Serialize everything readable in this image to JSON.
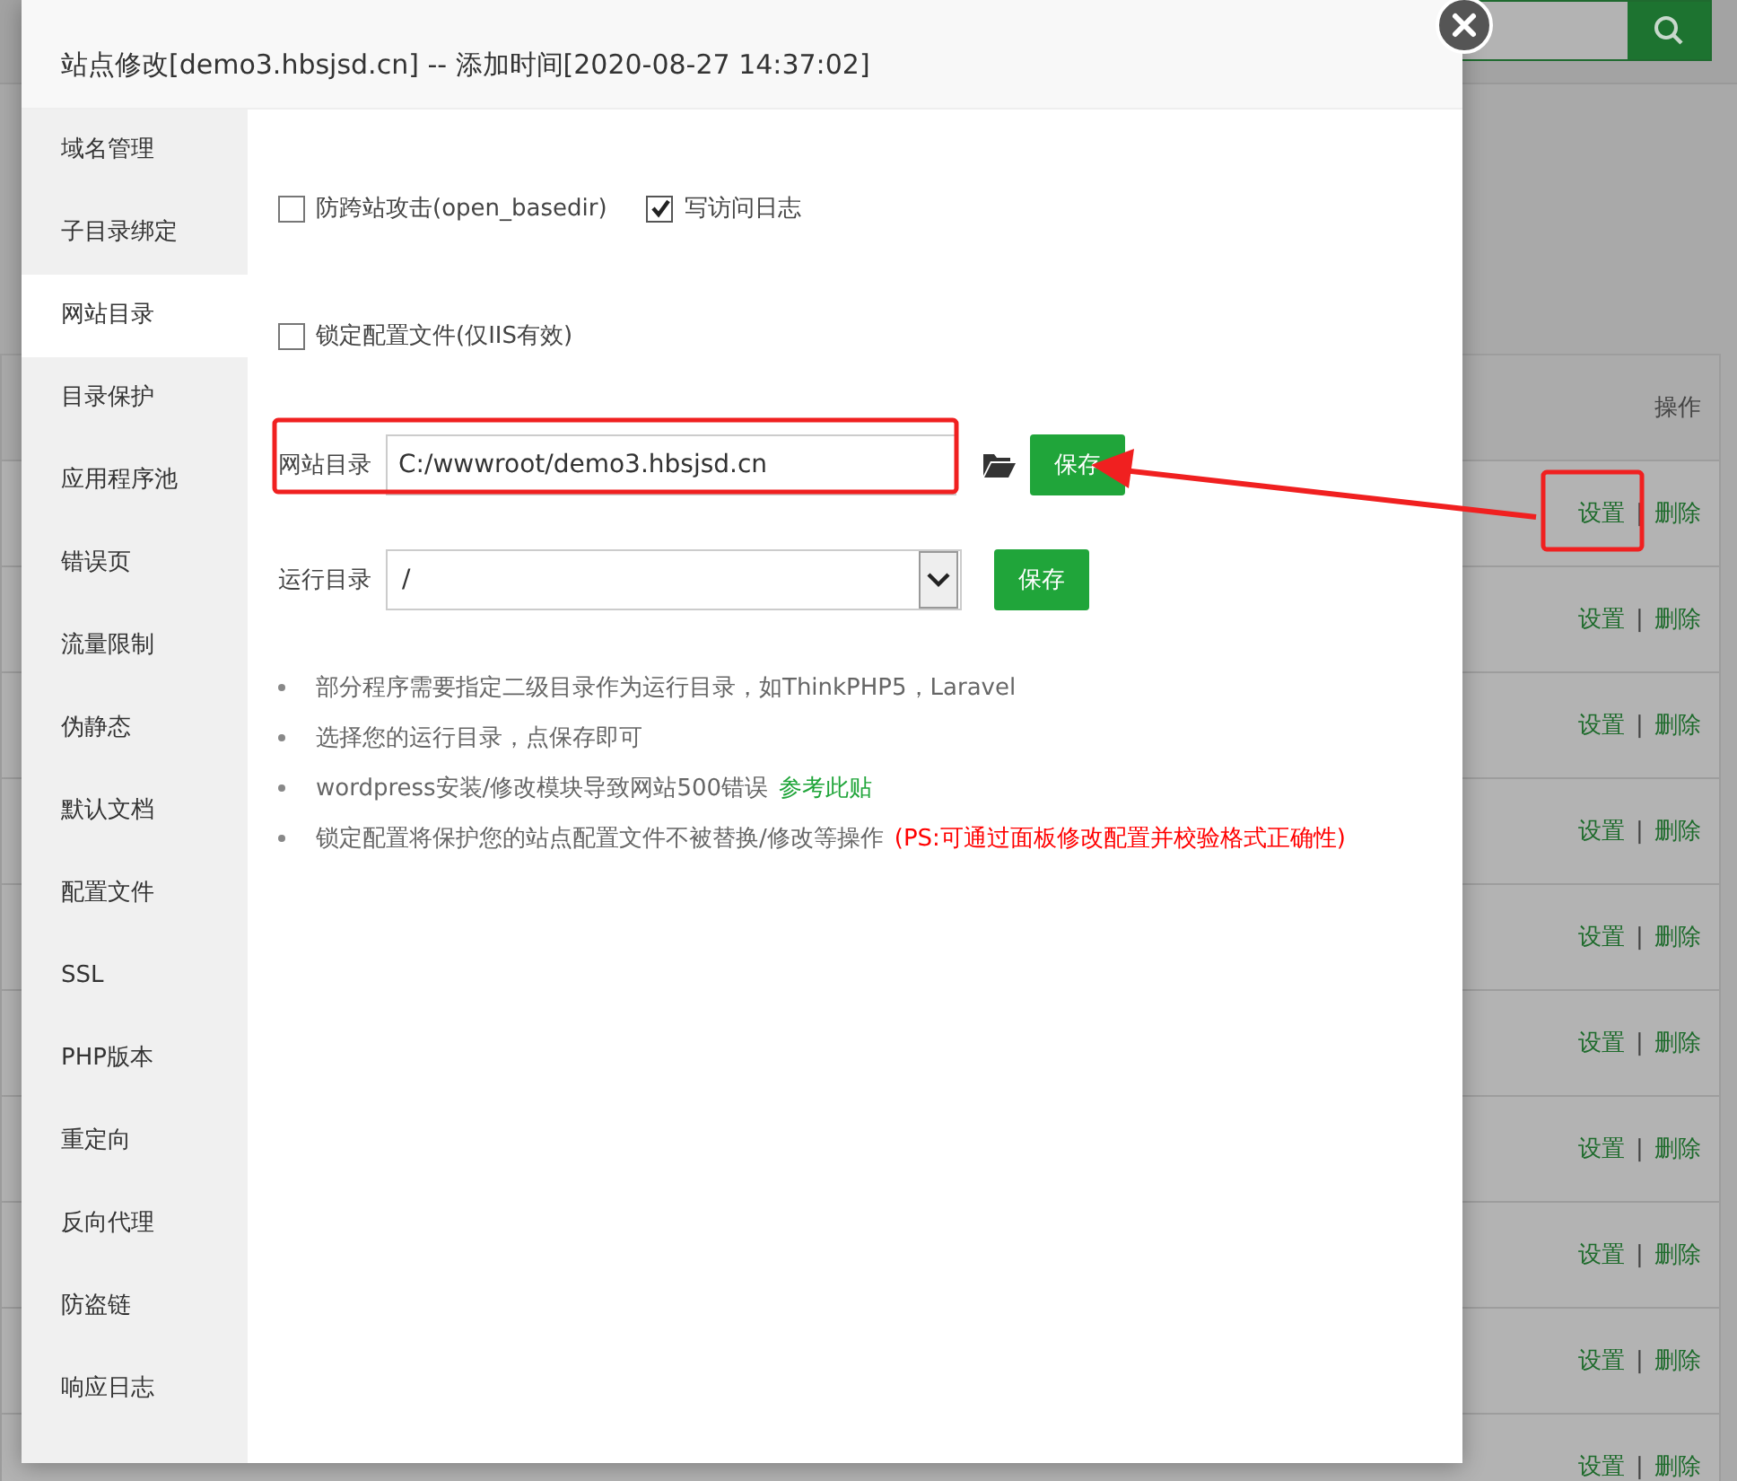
{
  "background_table": {
    "column_header": "操作",
    "rows": [
      {
        "edit": "设置",
        "separator": "|",
        "delete": "删除"
      },
      {
        "edit": "设置",
        "separator": "|",
        "delete": "删除"
      },
      {
        "edit": "设置",
        "separator": "|",
        "delete": "删除"
      },
      {
        "edit": "设置",
        "separator": "|",
        "delete": "删除"
      },
      {
        "edit": "设置",
        "separator": "|",
        "delete": "删除"
      },
      {
        "edit": "设置",
        "separator": "|",
        "delete": "删除"
      },
      {
        "edit": "设置",
        "separator": "|",
        "delete": "删除"
      },
      {
        "edit": "设置",
        "separator": "|",
        "delete": "删除"
      },
      {
        "edit": "设置",
        "separator": "|",
        "delete": "删除"
      },
      {
        "edit": "设置",
        "separator": "|",
        "delete": "删除"
      }
    ]
  },
  "dialog": {
    "title": "站点修改[demo3.hbsjsd.cn] -- 添加时间[2020-08-27 14:37:02]",
    "sidebar": {
      "items": [
        {
          "label": "域名管理",
          "selected": false
        },
        {
          "label": "子目录绑定",
          "selected": false
        },
        {
          "label": "网站目录",
          "selected": true
        },
        {
          "label": "目录保护",
          "selected": false
        },
        {
          "label": "应用程序池",
          "selected": false
        },
        {
          "label": "错误页",
          "selected": false
        },
        {
          "label": "流量限制",
          "selected": false
        },
        {
          "label": "伪静态",
          "selected": false
        },
        {
          "label": "默认文档",
          "selected": false
        },
        {
          "label": "配置文件",
          "selected": false
        },
        {
          "label": "SSL",
          "selected": false
        },
        {
          "label": "PHP版本",
          "selected": false
        },
        {
          "label": "重定向",
          "selected": false
        },
        {
          "label": "反向代理",
          "selected": false
        },
        {
          "label": "防盗链",
          "selected": false
        },
        {
          "label": "响应日志",
          "selected": false
        }
      ]
    },
    "option_rows": [
      [
        {
          "label": "防跨站攻击(open_basedir)",
          "checked": false
        },
        {
          "label": "写访问日志",
          "checked": true
        }
      ],
      [
        {
          "label": "锁定配置文件(仅IIS有效)",
          "checked": false
        }
      ]
    ],
    "site_dir": {
      "label": "网站目录",
      "value": "C:/wwwroot/demo3.hbsjsd.cn",
      "button": "保存"
    },
    "run_dir": {
      "label": "运行目录",
      "value": "/",
      "button": "保存"
    },
    "notes": [
      {
        "text": "部分程序需要指定二级目录作为运行目录，如ThinkPHP5，Laravel"
      },
      {
        "text": "选择您的运行目录，点保存即可"
      },
      {
        "text": "wordpress安装/修改模块导致网站500错误",
        "link": "参考此贴"
      },
      {
        "text": "锁定配置将保护您的站点配置文件不被替换/修改等操作",
        "warning": "(PS:可通过面板修改配置并校验格式正确性)"
      }
    ]
  }
}
